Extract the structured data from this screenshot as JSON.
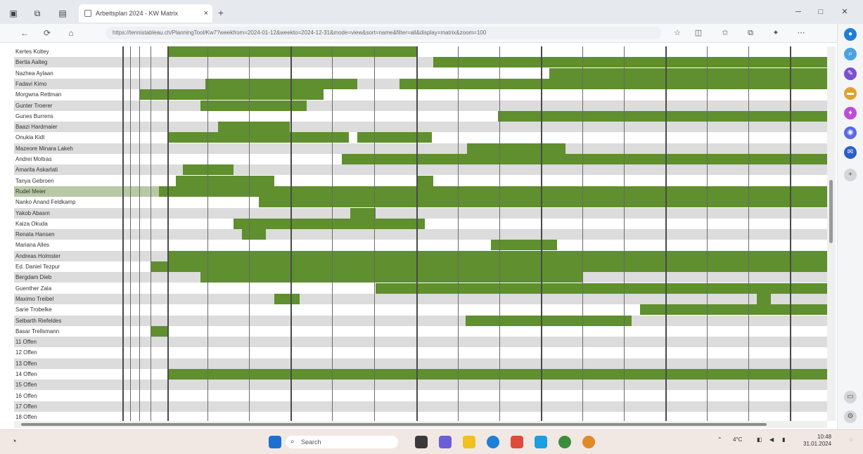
{
  "browser": {
    "tab_title": "Arbeitsplan 2024 - KW Matrix",
    "tab_close": "×",
    "new_tab": "+",
    "url": "https://tennistableau.ch/PlanningTool/Kw7?weekfrom=2024-01-12&weekto=2024-12-31&mode=view&sort=name&filter=all&display=matrix&zoom=100",
    "buttons": {
      "back": "←",
      "refresh": "⟳",
      "home": "⌂",
      "minimize": "─",
      "maximize": "□",
      "close": "✕"
    }
  },
  "timeline": {
    "rows": [
      {
        "name": "Kertes Koltey",
        "bars": [
          [
            218,
            572
          ]
        ]
      },
      {
        "name": "Bertia Aalteg",
        "bars": [
          [
            596,
            1156
          ]
        ]
      },
      {
        "name": "Nazhea Aylaan",
        "bars": [
          [
            761,
            1156
          ]
        ]
      },
      {
        "name": "Fadavi Kimo",
        "bars": [
          [
            272,
            488
          ],
          [
            548,
            1156
          ]
        ]
      },
      {
        "name": "Morgwna Rettman",
        "bars": [
          [
            178,
            440
          ]
        ]
      },
      {
        "name": "Gunter Troerer",
        "bars": [
          [
            265,
            416
          ]
        ]
      },
      {
        "name": "Gunes Burrens",
        "bars": [
          [
            688,
            1156
          ]
        ]
      },
      {
        "name": "Baazi Hardmaier",
        "bars": [
          [
            290,
            392
          ]
        ]
      },
      {
        "name": "Onukia Kidt",
        "bars": [
          [
            218,
            476
          ],
          [
            488,
            594
          ]
        ]
      },
      {
        "name": "Mazeore Minara Lakeh",
        "bars": [
          [
            644,
            784
          ]
        ]
      },
      {
        "name": "Andrei Moltras",
        "bars": [
          [
            466,
            1156
          ]
        ]
      },
      {
        "name": "Amarita Askarlati",
        "bars": [
          [
            240,
            312
          ]
        ]
      },
      {
        "name": "Tanya Gebroen",
        "bars": [
          [
            230,
            370
          ],
          [
            572,
            596
          ]
        ]
      },
      {
        "name": "Rudel Meier",
        "bars": [
          [
            206,
            1156
          ]
        ]
      },
      {
        "name": "Nanko Anand Feldkamp",
        "bars": [
          [
            348,
            1156
          ]
        ]
      },
      {
        "name": "Yakob Abasm",
        "bars": [
          [
            478,
            514
          ]
        ]
      },
      {
        "name": "Kaiza Okuda",
        "bars": [
          [
            312,
            584
          ]
        ]
      },
      {
        "name": "Renata Hansen",
        "bars": [
          [
            324,
            358
          ]
        ]
      },
      {
        "name": "Mariana Alles",
        "bars": [
          [
            678,
            772
          ]
        ]
      },
      {
        "name": "Andreas Holmster",
        "bars": [
          [
            218,
            1156
          ]
        ]
      },
      {
        "name": "Ed. Daniel Tezpur",
        "bars": [
          [
            194,
            1156
          ]
        ]
      },
      {
        "name": "Bergdam Dieb",
        "bars": [
          [
            265,
            808
          ]
        ]
      },
      {
        "name": "Guenther Zala",
        "bars": [
          [
            514,
            1156
          ]
        ]
      },
      {
        "name": "Maximo Treibel",
        "bars": [
          [
            370,
            406
          ],
          [
            1056,
            1076
          ]
        ]
      },
      {
        "name": "Sarie Trobelke",
        "bars": [
          [
            890,
            1156
          ]
        ]
      },
      {
        "name": "Selbarth Riefeldes",
        "bars": [
          [
            642,
            878
          ]
        ]
      },
      {
        "name": "Basar Trellsmann",
        "bars": [
          [
            194,
            218
          ]
        ]
      },
      {
        "name": "11 Offen",
        "bars": []
      },
      {
        "name": "12 Offen",
        "bars": []
      },
      {
        "name": "13 Offen",
        "bars": []
      },
      {
        "name": "14 Offen",
        "bars": [
          [
            218,
            1156
          ]
        ]
      },
      {
        "name": "15 Offen",
        "bars": []
      },
      {
        "name": "16 Offen",
        "bars": []
      },
      {
        "name": "17 Offen",
        "bars": []
      },
      {
        "name": "18 Offen",
        "bars": []
      }
    ],
    "selected_row": 13,
    "top_marks": [
      [
        488,
        520
      ],
      [
        548,
        668
      ],
      [
        822,
        856
      ],
      [
        978,
        998
      ]
    ]
  },
  "taskbar": {
    "search_placeholder": "Search",
    "clock_time": "10:48",
    "clock_date": "31.01.2024",
    "weather": "4°C"
  },
  "colors": {
    "bar": "#5f8f2e",
    "row_alt": "#dcdcdc",
    "selected": "#b9c9a6"
  }
}
